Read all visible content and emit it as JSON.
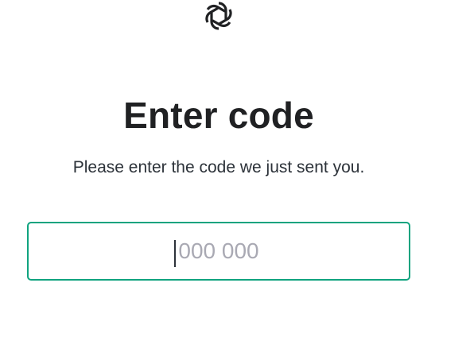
{
  "logo": {
    "icon": "openai-logo-icon"
  },
  "heading": {
    "title": "Enter code",
    "subtitle": "Please enter the code we just sent you."
  },
  "code_input": {
    "value": "",
    "placeholder": "000 000"
  },
  "colors": {
    "accent": "#10a37f",
    "text": "#202123",
    "placeholder": "#a9a9b3"
  }
}
